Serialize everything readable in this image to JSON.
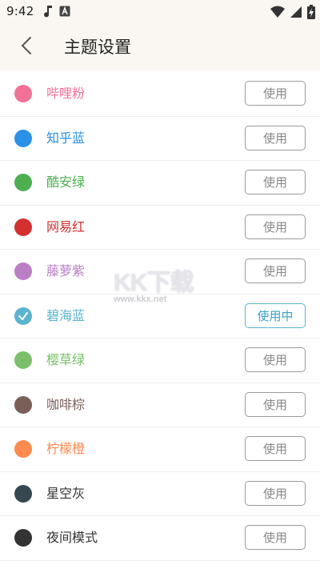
{
  "status_bar": {
    "time": "9:42",
    "left_icons": [
      "music-note-icon",
      "a-box-icon"
    ],
    "right_icons": [
      "wifi-icon",
      "cellular-signal-icon",
      "battery-charging-icon"
    ]
  },
  "header": {
    "title": "主题设置",
    "back_icon": "chevron-left-icon"
  },
  "watermark": {
    "logo_text": "KK下载",
    "url": "www.kkx.net"
  },
  "themes": [
    {
      "name": "哔哩粉",
      "color": "#f27197",
      "button": "使用",
      "selected": false
    },
    {
      "name": "知乎蓝",
      "color": "#2a91e8",
      "button": "使用",
      "selected": false
    },
    {
      "name": "酷安绿",
      "color": "#4caf50",
      "button": "使用",
      "selected": false
    },
    {
      "name": "网易红",
      "color": "#d32f2f",
      "button": "使用",
      "selected": false
    },
    {
      "name": "藤萝紫",
      "color": "#ba7ec4",
      "button": "使用",
      "selected": false
    },
    {
      "name": "碧海蓝",
      "color": "#5ab3cf",
      "button": "使用中",
      "selected": true
    },
    {
      "name": "樱草绿",
      "color": "#7cbf6a",
      "button": "使用",
      "selected": false
    },
    {
      "name": "咖啡棕",
      "color": "#795f58",
      "button": "使用",
      "selected": false
    },
    {
      "name": "柠檬橙",
      "color": "#ff8a50",
      "button": "使用",
      "selected": false
    },
    {
      "name": "星空灰",
      "color": "#37474f",
      "button": "使用",
      "selected": false
    },
    {
      "name": "夜间模式",
      "color": "#333333",
      "button": "使用",
      "selected": false
    }
  ]
}
